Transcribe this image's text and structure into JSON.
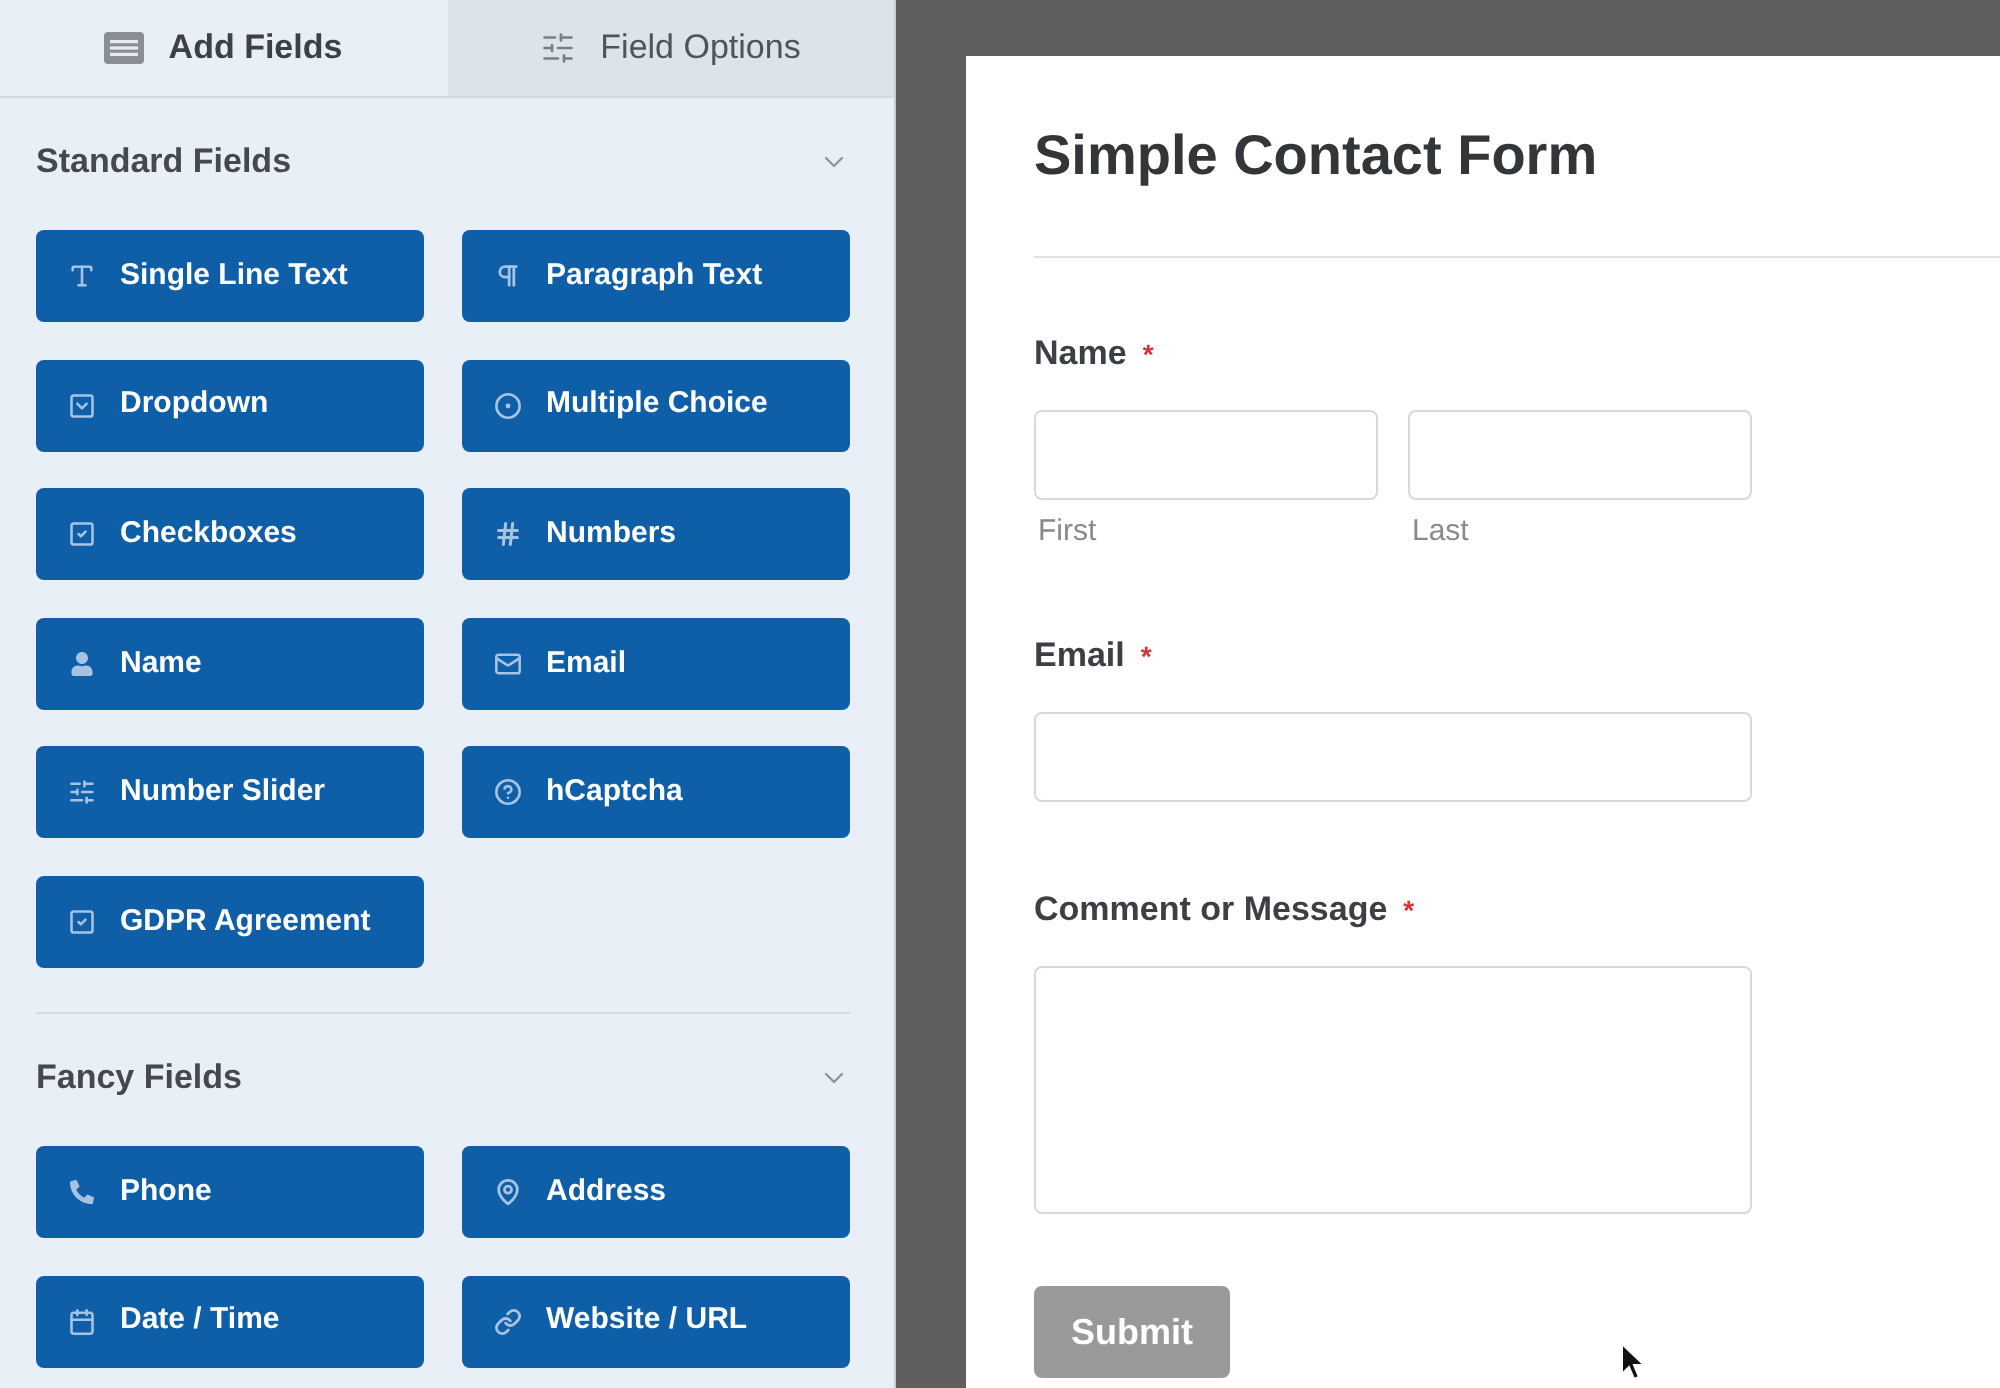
{
  "sidebar": {
    "tabs": [
      {
        "label": "Add Fields",
        "selected": true
      },
      {
        "label": "Field Options",
        "selected": false
      }
    ],
    "sections": [
      {
        "title": "Standard Fields",
        "expanded": true,
        "fields": [
          {
            "label": "Single Line Text"
          },
          {
            "label": "Paragraph Text"
          },
          {
            "label": "Dropdown"
          },
          {
            "label": "Multiple Choice"
          },
          {
            "label": "Checkboxes"
          },
          {
            "label": "Numbers"
          },
          {
            "label": "Name"
          },
          {
            "label": "Email"
          },
          {
            "label": "Number Slider"
          },
          {
            "label": "hCaptcha"
          },
          {
            "label": "GDPR Agreement"
          }
        ]
      },
      {
        "title": "Fancy Fields",
        "expanded": true,
        "fields": [
          {
            "label": "Phone"
          },
          {
            "label": "Address"
          },
          {
            "label": "Date / Time"
          },
          {
            "label": "Website / URL"
          }
        ]
      }
    ]
  },
  "form": {
    "title": "Simple Contact Form",
    "fields": [
      {
        "kind": "name",
        "label": "Name",
        "required_mark": "*",
        "subfields": [
          {
            "sublabel": "First"
          },
          {
            "sublabel": "Last"
          }
        ]
      },
      {
        "kind": "email",
        "label": "Email",
        "required_mark": "*"
      },
      {
        "kind": "textarea",
        "label": "Comment or Message",
        "required_mark": "*"
      }
    ],
    "submit": {
      "label": "Submit"
    }
  }
}
